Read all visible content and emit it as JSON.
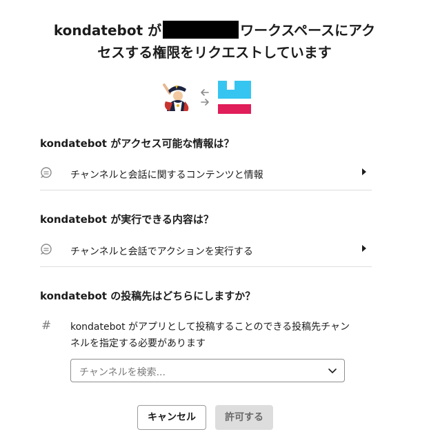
{
  "header": {
    "title_prefix": "kondatebot が",
    "title_suffix": "ワークスペースにアク",
    "title_line2": "セスする権限をリクエストしています"
  },
  "icons": {
    "app_avatar": "bot-avatar-icon",
    "arrows": "swap-arrows-icon",
    "workspace_logo": "workspace-logo-icon",
    "workspace_colors": [
      "#36c5f0",
      "#e01e5a"
    ]
  },
  "sections": {
    "access": {
      "heading": "kondatebot がアクセス可能な情報は？",
      "item_label": "チャンネルと会話に関するコンテンツと情報"
    },
    "actions": {
      "heading": "kondatebot が実行できる内容は？",
      "item_label": "チャンネルと会話でアクションを実行する"
    },
    "post": {
      "heading": "kondatebot の投稿先はどちらにしますか？",
      "hash_symbol": "#",
      "description": "kondatebot がアプリとして投稿することのできる投稿先チャンネルを指定する必要があります",
      "select_placeholder": "チャンネルを検索..."
    }
  },
  "buttons": {
    "cancel": "キャンセル",
    "allow": "許可する"
  }
}
